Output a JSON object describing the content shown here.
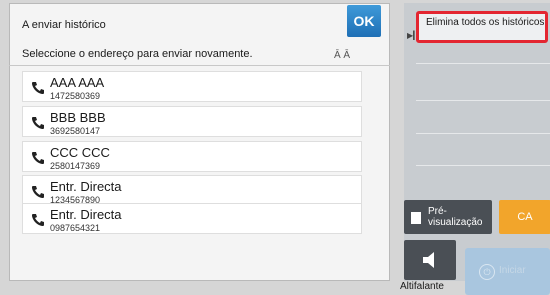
{
  "title": "A enviar histórico",
  "ok_label": "OK",
  "instruction": "Seleccione o endereço para enviar novamente.",
  "sort_label": "Ā Ā",
  "history": [
    {
      "name": "AAA AAA",
      "number": "1472580369"
    },
    {
      "name": "BBB BBB",
      "number": "3692580147"
    },
    {
      "name": "CCC CCC",
      "number": "2580147369"
    },
    {
      "name": "Entr. Directa",
      "number": "1234567890"
    },
    {
      "name": "Entr. Directa",
      "number": "0987654321"
    }
  ],
  "delete_all_label": "Elimina todos os históricos",
  "preview_label": "Pré-visualização",
  "ca_label": "CA",
  "speaker_label": "Altifalante",
  "send_label": "Iniciar",
  "colors": {
    "ok_blue": "#2a82c8",
    "delete_border": "#e32631",
    "ca_orange": "#f2a52b",
    "dark_button": "#4a4f55"
  },
  "icons": {
    "history_item": "phone-icon",
    "preview": "preview-icon",
    "speaker": "speaker-icon",
    "send": "send-icon"
  }
}
